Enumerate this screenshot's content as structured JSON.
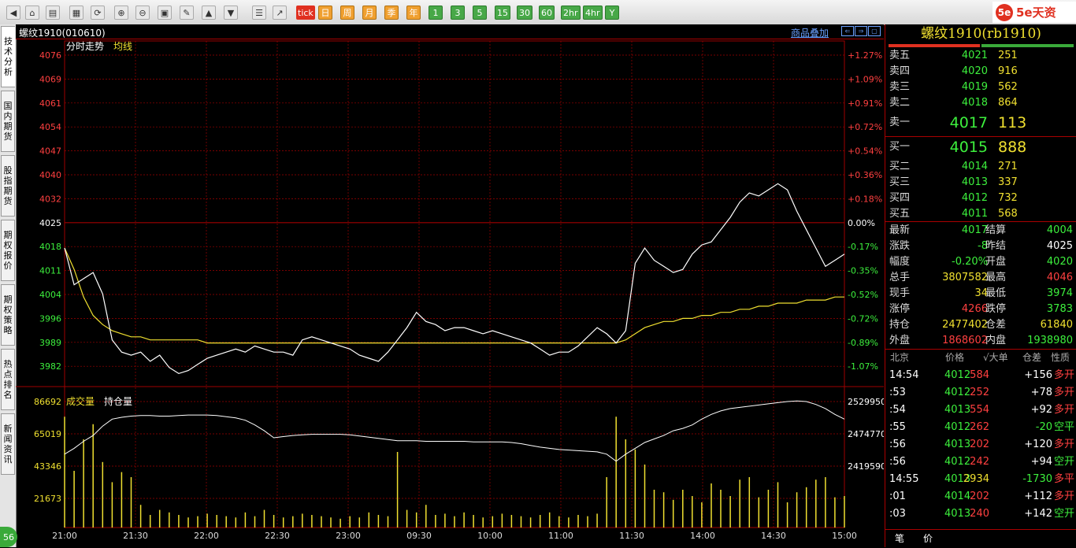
{
  "toolbar": {
    "period_buttons": [
      "日",
      "周",
      "月",
      "季",
      "年"
    ],
    "minute_buttons": [
      "1",
      "3",
      "5",
      "15",
      "30",
      "60",
      "2hr",
      "4hr",
      "Y"
    ],
    "tick_label": "tick",
    "brand_logo": "5e",
    "brand_text": "5e天资"
  },
  "sidebar": {
    "tabs": [
      "技术分析",
      "国内期货",
      "股指期货",
      "期权报价",
      "期权策略",
      "热点排名",
      "新闻资讯"
    ],
    "badge": "56"
  },
  "chart": {
    "title": "螺纹1910(010610)",
    "overlay_link": "商品叠加",
    "price_legend": "分时走势",
    "avg_legend": "均线",
    "vol_legend": "成交量",
    "oi_legend": "持仓量",
    "price_labels": [
      "4076",
      "4069",
      "4061",
      "4054",
      "4047",
      "4040",
      "4032",
      "4025",
      "4018",
      "4011",
      "4004",
      "3996",
      "3989",
      "3982"
    ],
    "pct_labels": [
      "+1.27%",
      "+1.09%",
      "+0.91%",
      "+0.72%",
      "+0.54%",
      "+0.36%",
      "+0.18%",
      "0.00%",
      "-0.17%",
      "-0.35%",
      "-0.52%",
      "-0.72%",
      "-0.89%",
      "-1.07%"
    ],
    "vol_labels": [
      "86692",
      "65019",
      "43346",
      "21673"
    ],
    "oi_labels": [
      "2529950",
      "2474770",
      "2419590"
    ],
    "time_labels": [
      "21:00",
      "21:30",
      "22:00",
      "22:30",
      "23:00",
      "09:30",
      "10:00",
      "11:00",
      "11:30",
      "14:00",
      "14:30",
      "15:00"
    ],
    "colors": {
      "up": "#ff4040",
      "down": "#3df03d",
      "grid": "#a00000",
      "avg": "#f0e030"
    }
  },
  "chart_data": {
    "type": "line",
    "ylim": [
      3975,
      4083
    ],
    "prev_settle": 4025,
    "x_labels": [
      "21:00",
      "21:30",
      "22:00",
      "22:30",
      "23:00",
      "09:30",
      "10:00",
      "11:00",
      "11:30",
      "14:00",
      "14:30",
      "15:00"
    ],
    "series": [
      {
        "values": [
          4020,
          4008,
          4010,
          4012,
          4005,
          3990,
          3986,
          3985,
          3986,
          3983,
          3985,
          3981,
          3979,
          3980,
          3982,
          3984,
          3985,
          3986,
          3987,
          3986,
          3988,
          3987,
          3986,
          3986,
          3985,
          3990,
          3991,
          3990,
          3989,
          3988,
          3987,
          3985,
          3984,
          3983,
          3986,
          3990,
          3994,
          3999,
          3996,
          3995,
          3993,
          3994,
          3994,
          3993,
          3992,
          3993,
          3992,
          3991,
          3990,
          3989,
          3987,
          3985,
          3986,
          3986,
          3988,
          3991,
          3994,
          3992,
          3989,
          3993,
          4015,
          4020,
          4016,
          4014,
          4012,
          4013,
          4018,
          4021,
          4022,
          4026,
          4030,
          4035,
          4038,
          4037,
          4039,
          4041,
          4039,
          4032,
          4026,
          4020,
          4014,
          4016,
          4018
        ]
      },
      {
        "values": [
          4020,
          4013,
          4004,
          3998,
          3995,
          3993,
          3992,
          3991,
          3991,
          3990,
          3990,
          3990,
          3990,
          3990,
          3990,
          3989,
          3989,
          3989,
          3989,
          3989,
          3989,
          3989,
          3989,
          3989,
          3989,
          3989,
          3989,
          3989,
          3989,
          3989,
          3989,
          3989,
          3989,
          3989,
          3989,
          3989,
          3989,
          3989,
          3989,
          3989,
          3989,
          3989,
          3989,
          3989,
          3989,
          3989,
          3989,
          3989,
          3989,
          3989,
          3989,
          3989,
          3989,
          3989,
          3989,
          3989,
          3989,
          3989,
          3989,
          3990,
          3992,
          3994,
          3995,
          3996,
          3996,
          3997,
          3997,
          3998,
          3998,
          3999,
          3999,
          4000,
          4000,
          4001,
          4001,
          4002,
          4002,
          4002,
          4003,
          4003,
          4003,
          4004,
          4004
        ]
      }
    ],
    "volume": [
      88,
      45,
      70,
      82,
      52,
      36,
      44,
      40,
      18,
      10,
      14,
      12,
      10,
      8,
      9,
      11,
      10,
      9,
      8,
      12,
      9,
      14,
      10,
      8,
      9,
      11,
      10,
      9,
      8,
      7,
      9,
      8,
      12,
      10,
      9,
      60,
      14,
      12,
      18,
      10,
      11,
      9,
      12,
      10,
      8,
      9,
      11,
      10,
      9,
      8,
      10,
      12,
      9,
      8,
      10,
      9,
      11,
      40,
      88,
      70,
      62,
      50,
      30,
      28,
      22,
      30,
      25,
      20,
      35,
      30,
      25,
      38,
      40,
      24,
      30,
      36,
      20,
      28,
      32,
      38,
      40,
      24,
      25
    ],
    "open_interest": [
      2440000,
      2450000,
      2462000,
      2472000,
      2488000,
      2500000,
      2503000,
      2505000,
      2506000,
      2506000,
      2505000,
      2505000,
      2506000,
      2507000,
      2507000,
      2507000,
      2506000,
      2504000,
      2502000,
      2498000,
      2490000,
      2480000,
      2468000,
      2470000,
      2472000,
      2473000,
      2474000,
      2474000,
      2474000,
      2474000,
      2473000,
      2471000,
      2469000,
      2467000,
      2465000,
      2463000,
      2463000,
      2463000,
      2462000,
      2462000,
      2462000,
      2462000,
      2462000,
      2461000,
      2461000,
      2461000,
      2461000,
      2460000,
      2458000,
      2455000,
      2452000,
      2450000,
      2448000,
      2447000,
      2446000,
      2445000,
      2444000,
      2440000,
      2428000,
      2440000,
      2450000,
      2460000,
      2466000,
      2472000,
      2480000,
      2484000,
      2490000,
      2500000,
      2508000,
      2514000,
      2518000,
      2520000,
      2522000,
      2524000,
      2526000,
      2528000,
      2530000,
      2531000,
      2530000,
      2525000,
      2518000,
      2508000,
      2500000
    ]
  },
  "quote": {
    "title": "螺纹1910(rb1910)",
    "asks": [
      {
        "label": "卖五",
        "price": "4021",
        "vol": "251"
      },
      {
        "label": "卖四",
        "price": "4020",
        "vol": "916"
      },
      {
        "label": "卖三",
        "price": "4019",
        "vol": "562"
      },
      {
        "label": "卖二",
        "price": "4018",
        "vol": "864"
      },
      {
        "label": "卖一",
        "price": "4017",
        "vol": "113"
      }
    ],
    "bids": [
      {
        "label": "买一",
        "price": "4015",
        "vol": "888"
      },
      {
        "label": "买二",
        "price": "4014",
        "vol": "271"
      },
      {
        "label": "买三",
        "price": "4013",
        "vol": "337"
      },
      {
        "label": "买四",
        "price": "4012",
        "vol": "732"
      },
      {
        "label": "买五",
        "price": "4011",
        "vol": "568"
      }
    ],
    "stats": [
      {
        "l1": "最新",
        "v1": "4017",
        "l2": "结算",
        "v2": "4004"
      },
      {
        "l1": "涨跌",
        "v1": "-8",
        "l2": "昨结",
        "v2": "4025"
      },
      {
        "l1": "幅度",
        "v1": "-0.20%",
        "l2": "开盘",
        "v2": "4020"
      },
      {
        "l1": "总手",
        "v1": "3807582",
        "l2": "最高",
        "v2": "4046"
      },
      {
        "l1": "现手",
        "v1": "34",
        "l2": "最低",
        "v2": "3974"
      },
      {
        "l1": "涨停",
        "v1": "4266",
        "l2": "跌停",
        "v2": "3783"
      },
      {
        "l1": "持仓",
        "v1": "2477402",
        "l2": "仓差",
        "v2": "61840"
      },
      {
        "l1": "外盘",
        "v1": "1868602",
        "l2": "内盘",
        "v2": "1938980"
      }
    ],
    "tick_header": {
      "time": "北京",
      "price": "价格",
      "vol": "√大单",
      "oi": "仓差",
      "nature": "性质"
    },
    "ticks": [
      {
        "time": "14:54",
        "price": "4012",
        "vol": "584",
        "oi": "+156",
        "nature": "多开"
      },
      {
        "time": ":53",
        "price": "4012",
        "vol": "252",
        "oi": "+78",
        "nature": "多开"
      },
      {
        "time": ":54",
        "price": "4013",
        "vol": "554",
        "oi": "+92",
        "nature": "多开"
      },
      {
        "time": ":55",
        "price": "4012",
        "vol": "262",
        "oi": "-20",
        "nature": "空平"
      },
      {
        "time": ":56",
        "price": "4013",
        "vol": "202",
        "oi": "+120",
        "nature": "多开"
      },
      {
        "time": ":56",
        "price": "4012",
        "vol": "242",
        "oi": "+94",
        "nature": "空开"
      },
      {
        "time": "14:55",
        "price": "4013",
        "vol": "2934",
        "oi": "-1730",
        "nature": "多平"
      },
      {
        "time": ":01",
        "price": "4014",
        "vol": "202",
        "oi": "+112",
        "nature": "多开"
      },
      {
        "time": ":03",
        "price": "4013",
        "vol": "240",
        "oi": "+142",
        "nature": "空开"
      }
    ],
    "bottom_tabs": [
      "笔",
      "价"
    ]
  }
}
